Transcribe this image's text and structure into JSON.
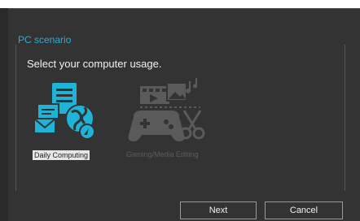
{
  "panel": {
    "title": "PC scenario",
    "subtitle": "Select your computer usage."
  },
  "options": [
    {
      "label": "Daily Computing",
      "icon": "daily-computing-icon",
      "selected": true
    },
    {
      "label": "Gaming/Media Editing",
      "icon": "gaming-media-icon",
      "selected": false
    }
  ],
  "buttons": {
    "next": "Next",
    "cancel": "Cancel"
  },
  "colors": {
    "accent": "#1fb3d8",
    "panel_bg": "#333333",
    "inactive_icon": "#5a5a5a"
  }
}
